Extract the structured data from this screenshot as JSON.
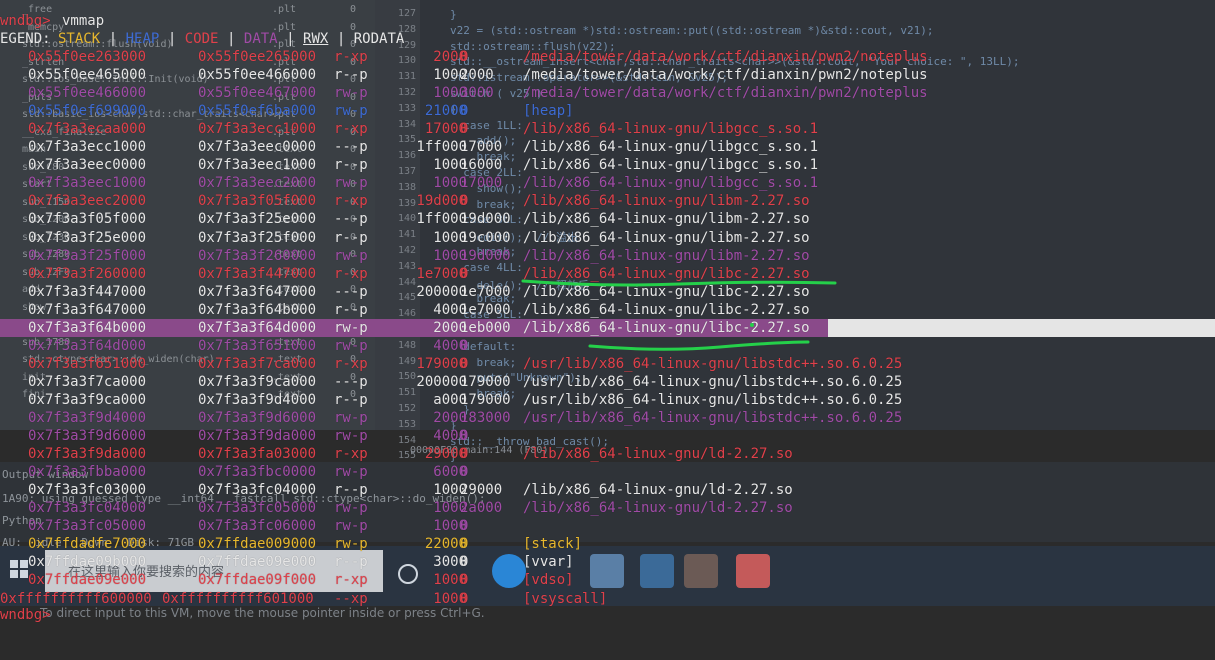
{
  "terminal": {
    "prompt": "wndbg>",
    "command": "vmmap",
    "bottom_prompt": "wndbg>",
    "legend": {
      "label": "EGEND:",
      "items": [
        {
          "text": "STACK",
          "color": "#e7b72d"
        },
        {
          "text": "|",
          "color": "#e6e6e6"
        },
        {
          "text": "HEAP",
          "color": "#3d6bd4"
        },
        {
          "text": "|",
          "color": "#e6e6e6"
        },
        {
          "text": "CODE",
          "color": "#e0404a"
        },
        {
          "text": "|",
          "color": "#e6e6e6"
        },
        {
          "text": "DATA",
          "color": "#a04ba6"
        },
        {
          "text": "|",
          "color": "#e6e6e6"
        },
        {
          "text": "RWX",
          "color": "#e6e6e6"
        },
        {
          "text": "|",
          "color": "#e6e6e6"
        },
        {
          "text": "RODATA",
          "color": "#e6e6e6"
        }
      ]
    },
    "mappings": [
      {
        "start": "0x55f0ee263000",
        "end": "0x55f0ee265000",
        "perm": "r-xp",
        "size": "2000",
        "offset": "0",
        "path": "/media/tower/data/work/ctf/dianxin/pwn2/noteplus",
        "type": "code"
      },
      {
        "start": "0x55f0ee465000",
        "end": "0x55f0ee466000",
        "perm": "r--p",
        "size": "1000",
        "offset": "2000",
        "path": "/media/tower/data/work/ctf/dianxin/pwn2/noteplus",
        "type": "ro"
      },
      {
        "start": "0x55f0ee466000",
        "end": "0x55f0ee467000",
        "perm": "rw-p",
        "size": "1000",
        "offset": "3000",
        "path": "/media/tower/data/work/ctf/dianxin/pwn2/noteplus",
        "type": "data"
      },
      {
        "start": "0x55f0ef699000",
        "end": "0x55f0ef6ba000",
        "perm": "rw-p",
        "size": "21000",
        "offset": "0",
        "path": "[heap]",
        "type": "heap"
      },
      {
        "start": "0x7f3a3ecaa000",
        "end": "0x7f3a3ecc1000",
        "perm": "r-xp",
        "size": "17000",
        "offset": "0",
        "path": "/lib/x86_64-linux-gnu/libgcc_s.so.1",
        "type": "code"
      },
      {
        "start": "0x7f3a3ecc1000",
        "end": "0x7f3a3eec0000",
        "perm": "---p",
        "size": "1ff000",
        "offset": "17000",
        "path": "/lib/x86_64-linux-gnu/libgcc_s.so.1",
        "type": "ro"
      },
      {
        "start": "0x7f3a3eec0000",
        "end": "0x7f3a3eec1000",
        "perm": "r--p",
        "size": "1000",
        "offset": "16000",
        "path": "/lib/x86_64-linux-gnu/libgcc_s.so.1",
        "type": "ro"
      },
      {
        "start": "0x7f3a3eec1000",
        "end": "0x7f3a3eec2000",
        "perm": "rw-p",
        "size": "1000",
        "offset": "17000",
        "path": "/lib/x86_64-linux-gnu/libgcc_s.so.1",
        "type": "data"
      },
      {
        "start": "0x7f3a3eec2000",
        "end": "0x7f3a3f05f000",
        "perm": "r-xp",
        "size": "19d000",
        "offset": "0",
        "path": "/lib/x86_64-linux-gnu/libm-2.27.so",
        "type": "code"
      },
      {
        "start": "0x7f3a3f05f000",
        "end": "0x7f3a3f25e000",
        "perm": "---p",
        "size": "1ff000",
        "offset": "19d000",
        "path": "/lib/x86_64-linux-gnu/libm-2.27.so",
        "type": "ro"
      },
      {
        "start": "0x7f3a3f25e000",
        "end": "0x7f3a3f25f000",
        "perm": "r--p",
        "size": "1000",
        "offset": "19c000",
        "path": "/lib/x86_64-linux-gnu/libm-2.27.so",
        "type": "ro"
      },
      {
        "start": "0x7f3a3f25f000",
        "end": "0x7f3a3f260000",
        "perm": "rw-p",
        "size": "1000",
        "offset": "19d000",
        "path": "/lib/x86_64-linux-gnu/libm-2.27.so",
        "type": "data"
      },
      {
        "start": "0x7f3a3f260000",
        "end": "0x7f3a3f447000",
        "perm": "r-xp",
        "size": "1e7000",
        "offset": "0",
        "path": "/lib/x86_64-linux-gnu/libc-2.27.so",
        "type": "code"
      },
      {
        "start": "0x7f3a3f447000",
        "end": "0x7f3a3f647000",
        "perm": "---p",
        "size": "200000",
        "offset": "1e7000",
        "path": "/lib/x86_64-linux-gnu/libc-2.27.so",
        "type": "ro"
      },
      {
        "start": "0x7f3a3f647000",
        "end": "0x7f3a3f64b000",
        "perm": "r--p",
        "size": "4000",
        "offset": "1e7000",
        "path": "/lib/x86_64-linux-gnu/libc-2.27.so",
        "type": "ro"
      },
      {
        "start": "0x7f3a3f64b000",
        "end": "0x7f3a3f64d000",
        "perm": "rw-p",
        "size": "2000",
        "offset": "1eb000",
        "path": "/lib/x86_64-linux-gnu/libc-2.27.so",
        "type": "selected"
      },
      {
        "start": "0x7f3a3f64d000",
        "end": "0x7f3a3f651000",
        "perm": "rw-p",
        "size": "4000",
        "offset": "0",
        "path": "",
        "type": "data"
      },
      {
        "start": "0x7f3a3f651000",
        "end": "0x7f3a3f7ca000",
        "perm": "r-xp",
        "size": "179000",
        "offset": "0",
        "path": "/usr/lib/x86_64-linux-gnu/libstdc++.so.6.0.25",
        "type": "code"
      },
      {
        "start": "0x7f3a3f7ca000",
        "end": "0x7f3a3f9ca000",
        "perm": "---p",
        "size": "200000",
        "offset": "179000",
        "path": "/usr/lib/x86_64-linux-gnu/libstdc++.so.6.0.25",
        "type": "ro"
      },
      {
        "start": "0x7f3a3f9ca000",
        "end": "0x7f3a3f9d4000",
        "perm": "r--p",
        "size": "a000",
        "offset": "179000",
        "path": "/usr/lib/x86_64-linux-gnu/libstdc++.so.6.0.25",
        "type": "ro"
      },
      {
        "start": "0x7f3a3f9d4000",
        "end": "0x7f3a3f9d6000",
        "perm": "rw-p",
        "size": "2000",
        "offset": "183000",
        "path": "/usr/lib/x86_64-linux-gnu/libstdc++.so.6.0.25",
        "type": "data"
      },
      {
        "start": "0x7f3a3f9d6000",
        "end": "0x7f3a3f9da000",
        "perm": "rw-p",
        "size": "4000",
        "offset": "0",
        "path": "",
        "type": "data"
      },
      {
        "start": "0x7f3a3f9da000",
        "end": "0x7f3a3fa03000",
        "perm": "r-xp",
        "size": "29000",
        "offset": "0",
        "path": "/lib/x86_64-linux-gnu/ld-2.27.so",
        "type": "code"
      },
      {
        "start": "0x7f3a3fbba000",
        "end": "0x7f3a3fbc0000",
        "perm": "rw-p",
        "size": "6000",
        "offset": "0",
        "path": "",
        "type": "data"
      },
      {
        "start": "0x7f3a3fc03000",
        "end": "0x7f3a3fc04000",
        "perm": "r--p",
        "size": "1000",
        "offset": "29000",
        "path": "/lib/x86_64-linux-gnu/ld-2.27.so",
        "type": "ro"
      },
      {
        "start": "0x7f3a3fc04000",
        "end": "0x7f3a3fc05000",
        "perm": "rw-p",
        "size": "1000",
        "offset": "2a000",
        "path": "/lib/x86_64-linux-gnu/ld-2.27.so",
        "type": "data"
      },
      {
        "start": "0x7f3a3fc05000",
        "end": "0x7f3a3fc06000",
        "perm": "rw-p",
        "size": "1000",
        "offset": "0",
        "path": "",
        "type": "data"
      },
      {
        "start": "0x7ffdadfe7000",
        "end": "0x7ffdae009000",
        "perm": "rw-p",
        "size": "22000",
        "offset": "0",
        "path": "[stack]",
        "type": "stack"
      },
      {
        "start": "0x7ffdae09b000",
        "end": "0x7ffdae09e000",
        "perm": "r--p",
        "size": "3000",
        "offset": "0",
        "path": "[vvar]",
        "type": "ro"
      },
      {
        "start": "0x7ffdae09e000",
        "end": "0x7ffdae09f000",
        "perm": "r-xp",
        "size": "1000",
        "offset": "0",
        "path": "[vdso]",
        "type": "code"
      },
      {
        "start": "0xffffffffff600000",
        "end": "0xffffffffff601000",
        "perm": "--xp",
        "size": "1000",
        "offset": "0",
        "path": "[vsyscall]",
        "type": "vsyscall"
      }
    ]
  },
  "colors": {
    "code": "#e0404a",
    "ro": "#e6e6e6",
    "data": "#a04ba6",
    "heap": "#3d6bd4",
    "stack": "#e7b72d",
    "selected": "#e6e6e6",
    "vsyscall": "#e0404a",
    "annotation": "#25d04a",
    "highlight_row": "#8a4a8a"
  },
  "ide": {
    "functions": [
      {
        "name": "_free",
        "seg": ".plt",
        "zero": "0"
      },
      {
        "name": "_memcpy",
        "seg": ".plt",
        "zero": "0"
      },
      {
        "name": "std::ostream::flush(void)",
        "seg": ".plt",
        "zero": "0"
      },
      {
        "name": "_strlen",
        "seg": ".plt",
        "zero": "0"
      },
      {
        "name": "std::ios_base::Init::Init(void)",
        "seg": ".plt",
        "zero": "0"
      },
      {
        "name": "_puts",
        "seg": ".plt",
        "zero": "0"
      },
      {
        "name": "std::basic_ios<char,std::char_traits<char>>",
        "seg": ".plt",
        "zero": "0"
      },
      {
        "name": "__cxa_finalize",
        "seg": ".plt",
        "zero": "0"
      },
      {
        "name": "main",
        "seg": ".text",
        "zero": "0"
      },
      {
        "name": "sub_C80",
        "seg": ".text",
        "zero": "0"
      },
      {
        "name": "start",
        "seg": ".text",
        "zero": "0"
      },
      {
        "name": "sub_1150",
        "seg": ".text",
        "zero": "0"
      },
      {
        "name": "sub_1200",
        "seg": ".text",
        "zero": "0"
      },
      {
        "name": "sub_1230",
        "seg": ".text",
        "zero": "0"
      },
      {
        "name": "sub_1280",
        "seg": ".text",
        "zero": "0"
      },
      {
        "name": "sub_12F0",
        "seg": ".text",
        "zero": "0"
      },
      {
        "name": "add",
        "seg": ".text",
        "zero": "0"
      },
      {
        "name": "show",
        "seg": ".text",
        "zero": "0"
      },
      {
        "name": "edit",
        "seg": ".text",
        "zero": "0"
      },
      {
        "name": "sub_1780",
        "seg": ".text",
        "zero": "0"
      },
      {
        "name": "std::ctype<char>::do_widen(char)",
        "seg": ".text",
        "zero": "0"
      },
      {
        "name": "init",
        "seg": ".text",
        "zero": "0"
      },
      {
        "name": "fini",
        "seg": ".text",
        "zero": "0"
      }
    ],
    "code_lines": [
      {
        "ln": "127",
        "text": "}"
      },
      {
        "ln": "128",
        "text": "v22 = (std::ostream *)std::ostream::put((std::ostream *)&std::cout, v21);"
      },
      {
        "ln": "129",
        "text": "std::ostream::flush(v22);"
      },
      {
        "ln": "130",
        "text": "std::__ostream_insert<char,std::char_traits<char>>(&std::cout, \"Your choice: \", 13LL);"
      },
      {
        "ln": "131",
        "text": "std::istream::operator>>(&std::cin, &v25);"
      },
      {
        "ln": "132",
        "text": "switch ( v25 )"
      },
      {
        "ln": "133",
        "text": "{"
      },
      {
        "ln": "134",
        "text": "  case 1LL:"
      },
      {
        "ln": "135",
        "text": "    add();"
      },
      {
        "ln": "136",
        "text": "    break;"
      },
      {
        "ln": "137",
        "text": "  case 2LL:"
      },
      {
        "ln": "138",
        "text": "    show();"
      },
      {
        "ln": "139",
        "text": "    break;"
      },
      {
        "ln": "140",
        "text": "  case 3LL:"
      },
      {
        "ln": "141",
        "text": "    edit();  // 溢出"
      },
      {
        "ln": "142",
        "text": "    break;"
      },
      {
        "ln": "143",
        "text": "  case 4LL:"
      },
      {
        "ln": "144",
        "text": "    dele();  // 释放后"
      },
      {
        "ln": "145",
        "text": "    break;"
      },
      {
        "ln": "146",
        "text": "  case 5LL:"
      },
      {
        "ln": "147",
        "text": "    return 0LL;"
      },
      {
        "ln": "148",
        "text": "  default:"
      },
      {
        "ln": "149",
        "text": "    break;"
      },
      {
        "ln": "150",
        "text": "    puts(\"Unknown\");"
      },
      {
        "ln": "151",
        "text": "    break;"
      },
      {
        "ln": "152",
        "text": "  }"
      },
      {
        "ln": "153",
        "text": "}"
      },
      {
        "ln": "154",
        "text": "std::__throw_bad_cast();"
      },
      {
        "ln": "155",
        "text": "}"
      }
    ],
    "status_line": "00000F80 main:144 (F80)",
    "output": {
      "title": "Output window",
      "lines": [
        "1A90: using guessed type __int64 __fastcall std::ctype<char>::do_widen();",
        "Python",
        "AU:  idle   Down   Disk: 71GB"
      ]
    },
    "taskbar": {
      "search_placeholder": "在这里输入你要搜索的内容"
    },
    "vm_hint": "To direct input to this VM, move the mouse pointer inside or press Ctrl+G."
  }
}
